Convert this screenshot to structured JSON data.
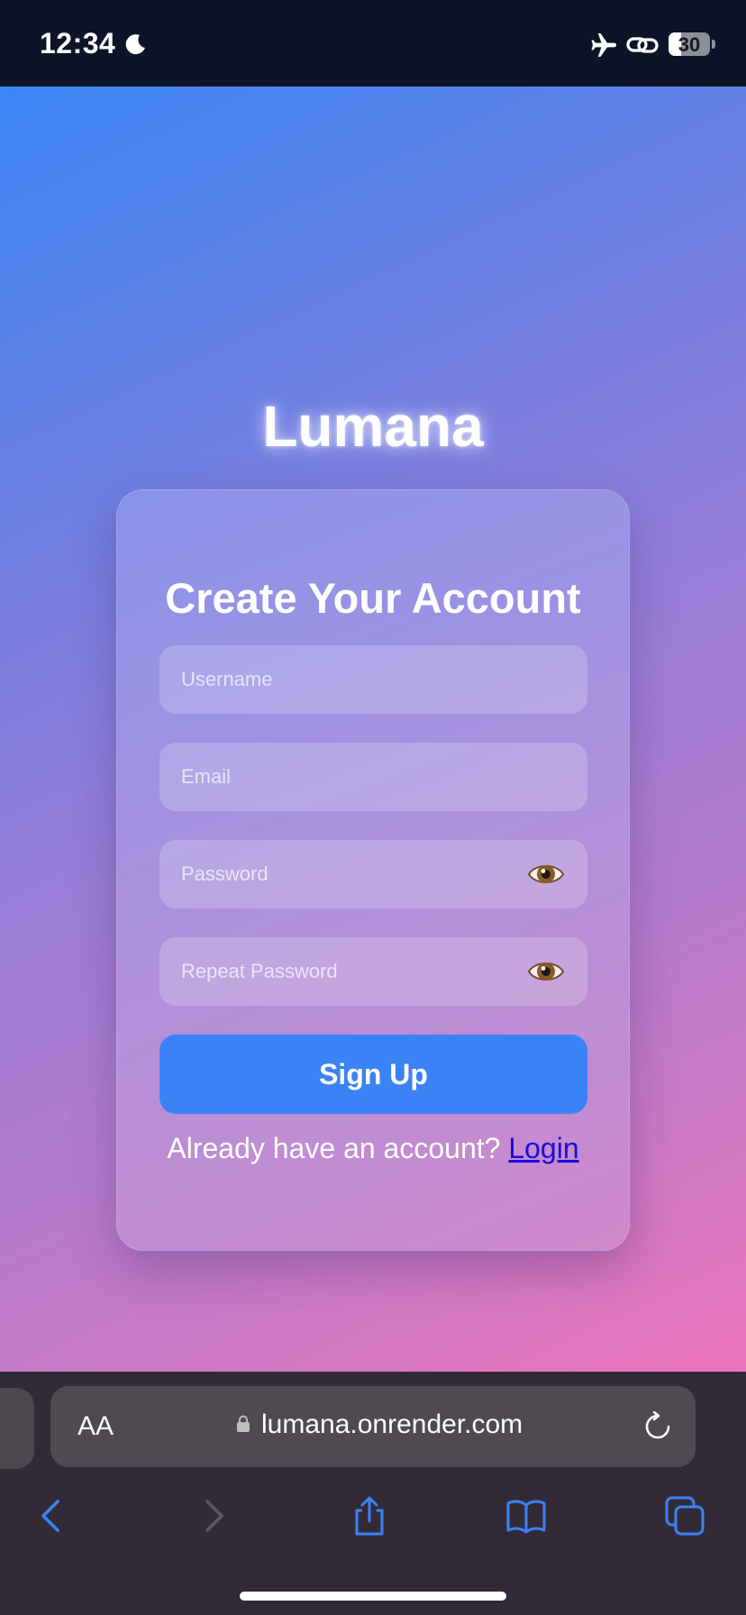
{
  "status_bar": {
    "time": "12:34",
    "battery_level": "30",
    "battery_fraction": 0.3,
    "icons": [
      "moon-icon",
      "airplane-icon",
      "link-icon",
      "battery-icon"
    ]
  },
  "page": {
    "brand": "Lumana",
    "form": {
      "title": "Create Your Account",
      "username_placeholder": "Username",
      "email_placeholder": "Email",
      "password_placeholder": "Password",
      "repeat_password_placeholder": "Repeat Password",
      "signup_label": "Sign Up",
      "footer_prompt": "Already have an account?",
      "login_label": "Login"
    },
    "colors": {
      "accent": "#3b82f6",
      "login_link": "#1a0ddb"
    }
  },
  "browser": {
    "text_size_label": "AA",
    "url": "lumana.onrender.com",
    "toolbar_icons": [
      "back-icon",
      "forward-icon",
      "share-icon",
      "bookmarks-icon",
      "tabs-icon"
    ]
  }
}
